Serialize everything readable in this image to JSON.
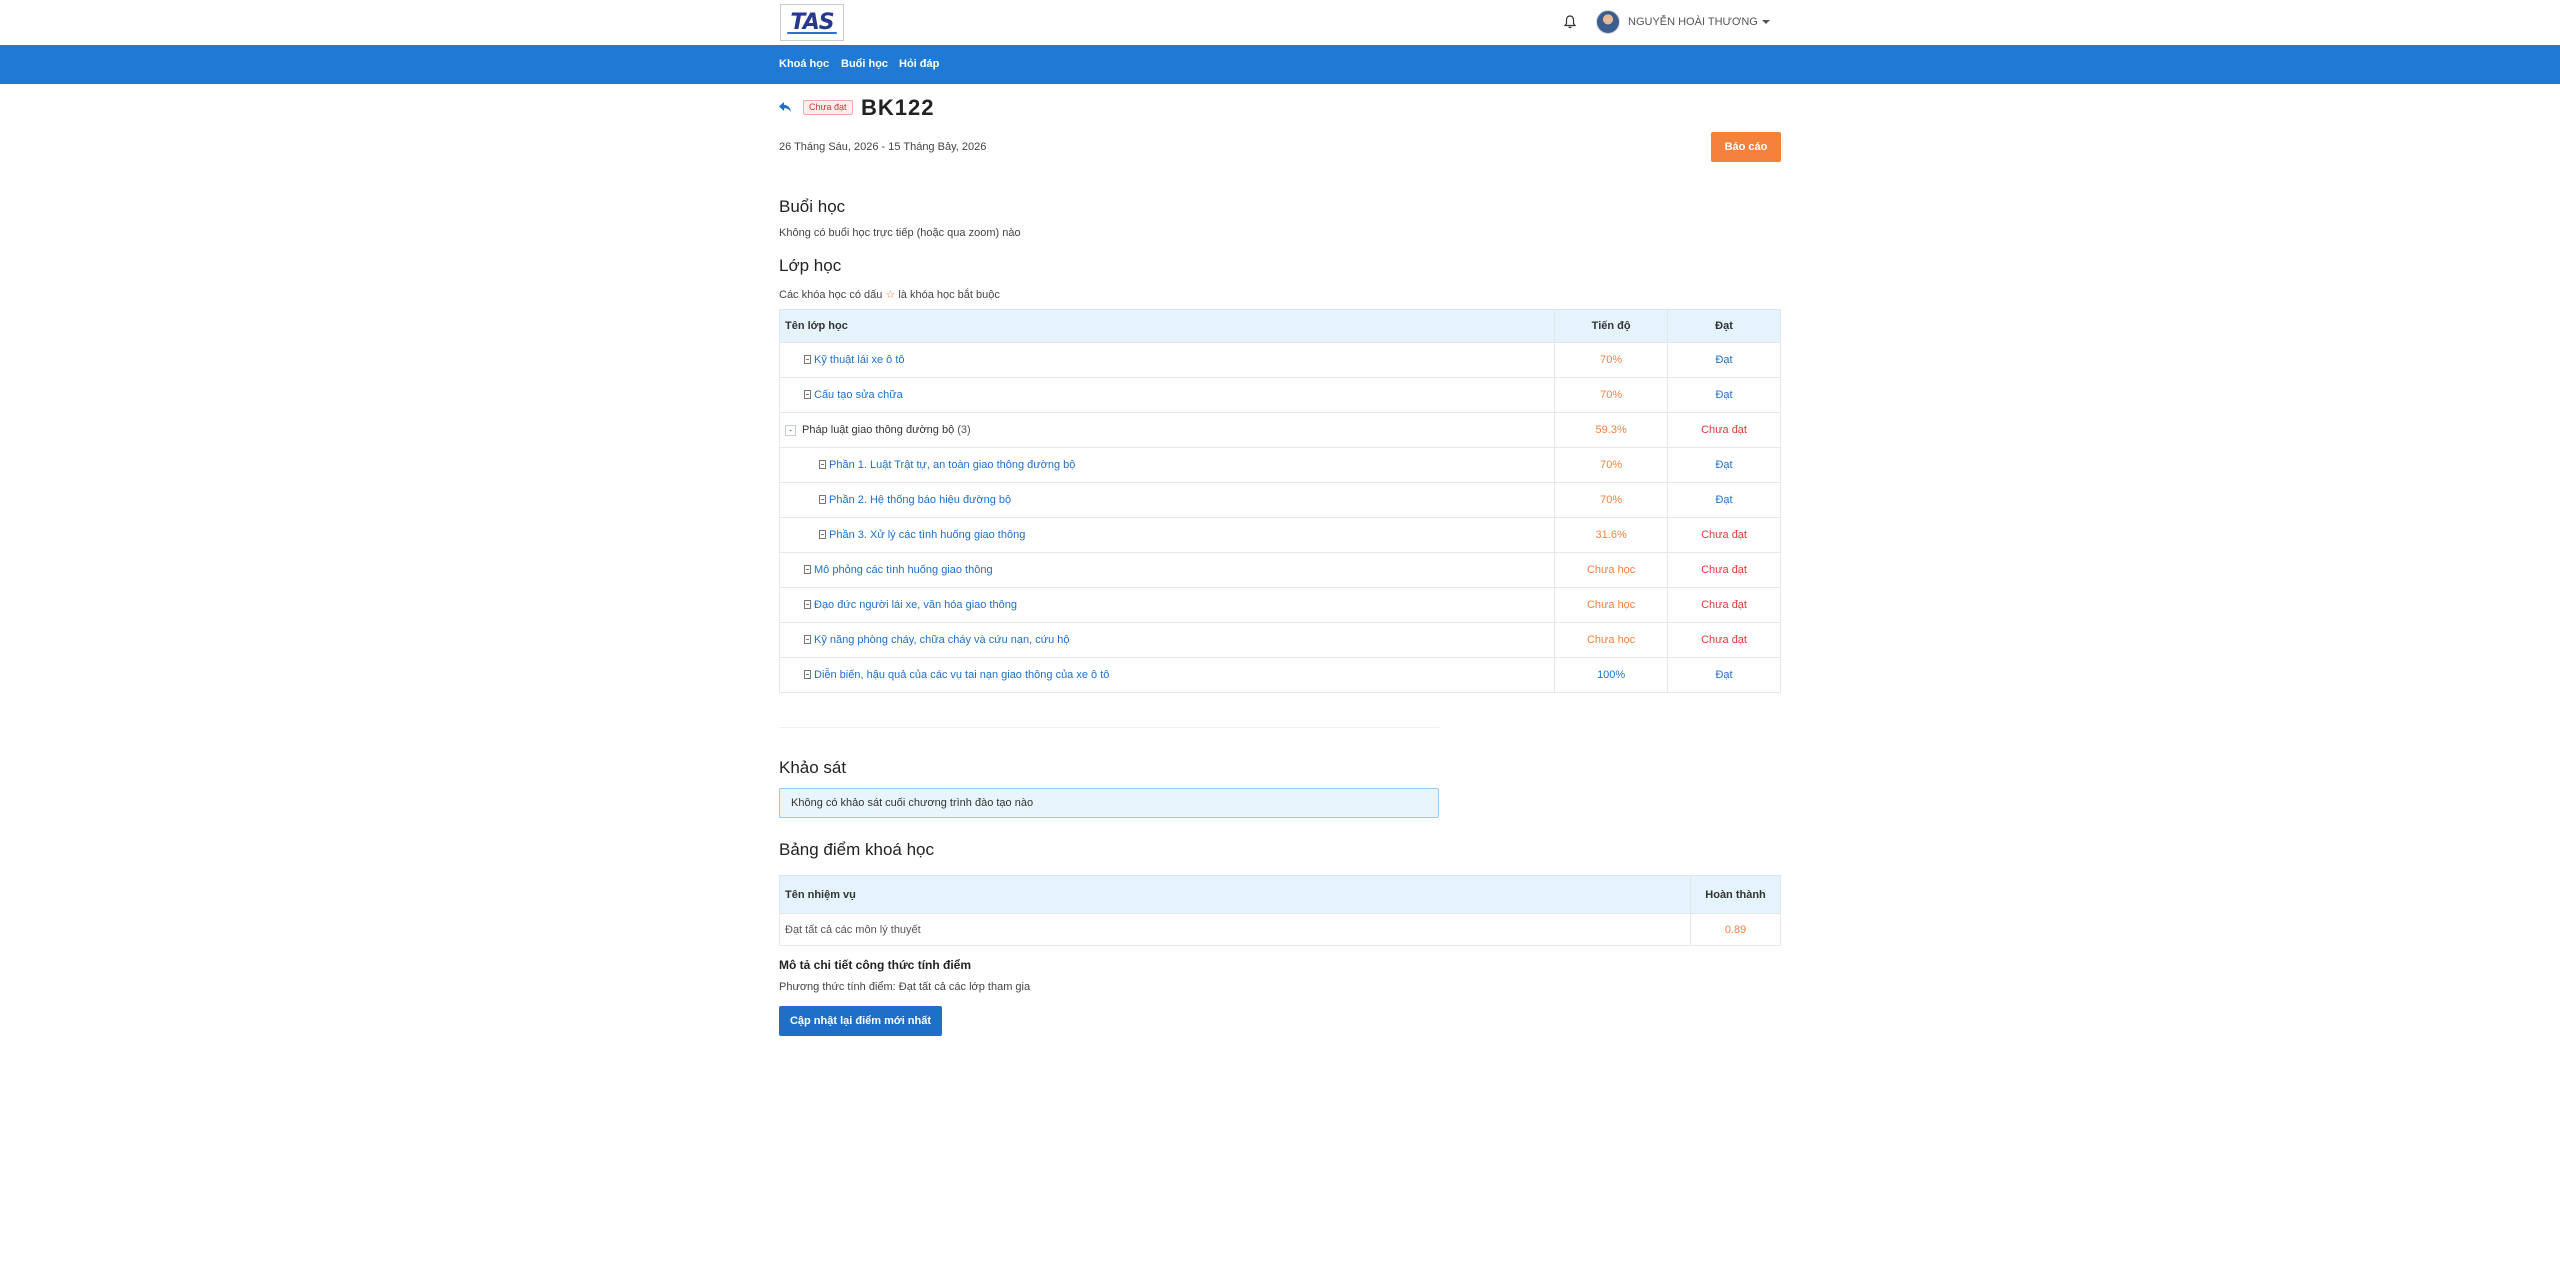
{
  "header": {
    "logo_text": "TAS",
    "user_name": "NGUYỄN HOÀI THƯƠNG"
  },
  "nav": {
    "items": [
      {
        "label": "Khoá học"
      },
      {
        "label": "Buổi học"
      },
      {
        "label": "Hỏi đáp"
      }
    ]
  },
  "course": {
    "status": "Chưa đạt",
    "title": "BK122",
    "date_range": "26 Tháng Sáu, 2026 - 15 Tháng Bảy, 2026",
    "report_label": "Báo cáo"
  },
  "sessions": {
    "heading": "Buổi học",
    "empty_text": "Không có buổi học trực tiếp (hoặc qua zoom) nào"
  },
  "classes": {
    "heading": "Lớp học",
    "note_before": "Các khóa học có dấu",
    "note_star": "☆",
    "note_after": "là khóa học bắt buộc",
    "columns": {
      "name": "Tên lớp học",
      "progress": "Tiến độ",
      "pass": "Đạt"
    },
    "rows": [
      {
        "name": "Kỹ thuật lái xe ô tô",
        "progress": "70%",
        "pass": "Đạt"
      },
      {
        "name": "Cấu tạo sửa chữa",
        "progress": "70%",
        "pass": "Đạt"
      },
      {
        "name": "Pháp luật giao thông đường bộ",
        "count": "(3)",
        "toggle": "-",
        "progress": "59.3%",
        "pass": "Chưa đạt"
      },
      {
        "name": "Phần 1. Luật Trật tự, an toàn giao thông đường bộ",
        "progress": "70%",
        "pass": "Đạt"
      },
      {
        "name": "Phần 2. Hệ thống báo hiệu đường bộ",
        "progress": "70%",
        "pass": "Đạt"
      },
      {
        "name": "Phần 3. Xử lý các tình huống giao thông",
        "progress": "31.6%",
        "pass": "Chưa đạt"
      },
      {
        "name": "Mô phỏng các tình huống giao thông",
        "progress": "Chưa học",
        "pass": "Chưa đạt"
      },
      {
        "name": "Đạo đức người lái xe, văn hóa giao thông",
        "progress": "Chưa học",
        "pass": "Chưa đạt"
      },
      {
        "name": "Kỹ năng phòng cháy, chữa cháy và cứu nạn, cứu hộ",
        "progress": "Chưa học",
        "pass": "Chưa đạt"
      },
      {
        "name": "Diễn biến, hậu quả của các vụ tai nạn giao thông của xe ô tô",
        "progress": "100%",
        "pass": "Đạt"
      }
    ]
  },
  "survey": {
    "heading": "Khảo sát",
    "empty_text": "Không có khảo sát cuối chương trình đào tạo nào"
  },
  "scores": {
    "heading": "Bảng điểm khoá học",
    "columns": {
      "task": "Tên nhiệm vụ",
      "done": "Hoàn thành"
    },
    "rows": [
      {
        "task": "Đạt tất cả các môn lý thuyết",
        "done": "0.89"
      }
    ],
    "formula_heading": "Mô tả chi tiết công thức tính điểm",
    "formula_text": "Phương thức tính điểm: Đạt tất cả các lớp tham gia",
    "update_label": "Cập nhật lại điểm mới nhất"
  },
  "colors": {
    "brand": "#1f7ad6",
    "accent_orange": "#f5813d",
    "fail_red": "#e03a3a",
    "link_blue": "#1f6fc9",
    "table_header": "#e4f3fc"
  },
  "icons": [
    "bell-icon",
    "back-arrow-icon",
    "document-icon",
    "caret-down-icon"
  ]
}
